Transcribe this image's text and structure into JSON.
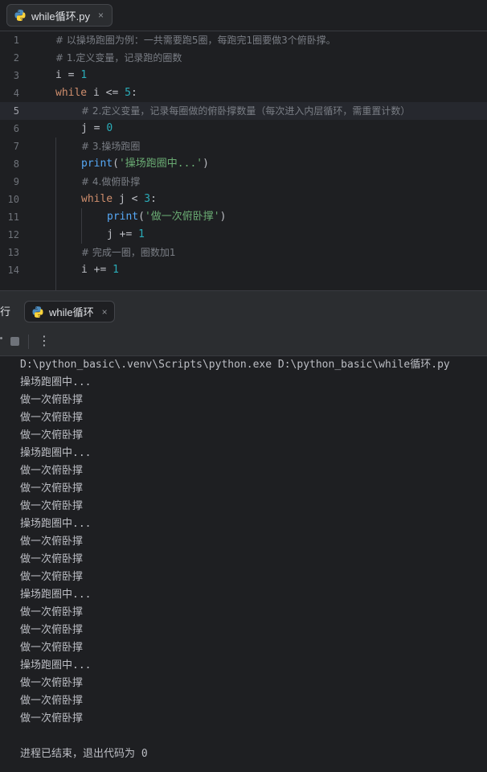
{
  "editor_tab": {
    "filename": "while循环.py",
    "close": "×",
    "icon": "python-file-icon"
  },
  "editor": {
    "line_numbers": [
      "1",
      "2",
      "3",
      "4",
      "5",
      "6",
      "7",
      "8",
      "9",
      "10",
      "11",
      "12",
      "13",
      "14"
    ],
    "current_line": 5
  },
  "code": {
    "l1": "# 以操场跑圈为例：一共需要跑5圈，每跑完1圈要做3个俯卧撑。",
    "l2": "# 1.定义变量，记录跑的圈数",
    "l3_var": "i",
    "l3_op": " = ",
    "l3_num": "1",
    "l4_kw": "while",
    "l4_mid": " i <= ",
    "l4_num": "5",
    "l4_end": ":",
    "l5": "# 2.定义变量，记录每圈做的俯卧撑数量（每次进入内层循环，需重置计数）",
    "l6_var": "j",
    "l6_op": " = ",
    "l6_num": "0",
    "l7": "# 3.操场跑圈",
    "l8_fn": "print",
    "l8_open": "(",
    "l8_str": "'操场跑圈中...'",
    "l8_close": ")",
    "l9": "# 4.做俯卧撑",
    "l10_kw": "while",
    "l10_mid": " j < ",
    "l10_num": "3",
    "l10_end": ":",
    "l11_fn": "print",
    "l11_open": "(",
    "l11_str": "'做一次俯卧撑'",
    "l11_close": ")",
    "l12_mid": "j += ",
    "l12_num": "1",
    "l13": "# 完成一圈，圈数加1",
    "l14_mid": "i += ",
    "l14_num": "1"
  },
  "run_panel": {
    "title": "行",
    "tab_label": "while循环",
    "tab_close": "×",
    "more": "⋮"
  },
  "console": {
    "command": "D:\\python_basic\\.venv\\Scripts\\python.exe D:\\python_basic\\while循环.py",
    "output": [
      "操场跑圈中...",
      "做一次俯卧撑",
      "做一次俯卧撑",
      "做一次俯卧撑",
      "操场跑圈中...",
      "做一次俯卧撑",
      "做一次俯卧撑",
      "做一次俯卧撑",
      "操场跑圈中...",
      "做一次俯卧撑",
      "做一次俯卧撑",
      "做一次俯卧撑",
      "操场跑圈中...",
      "做一次俯卧撑",
      "做一次俯卧撑",
      "做一次俯卧撑",
      "操场跑圈中...",
      "做一次俯卧撑",
      "做一次俯卧撑",
      "做一次俯卧撑"
    ],
    "exit_message": "进程已结束，退出代码为 0"
  }
}
